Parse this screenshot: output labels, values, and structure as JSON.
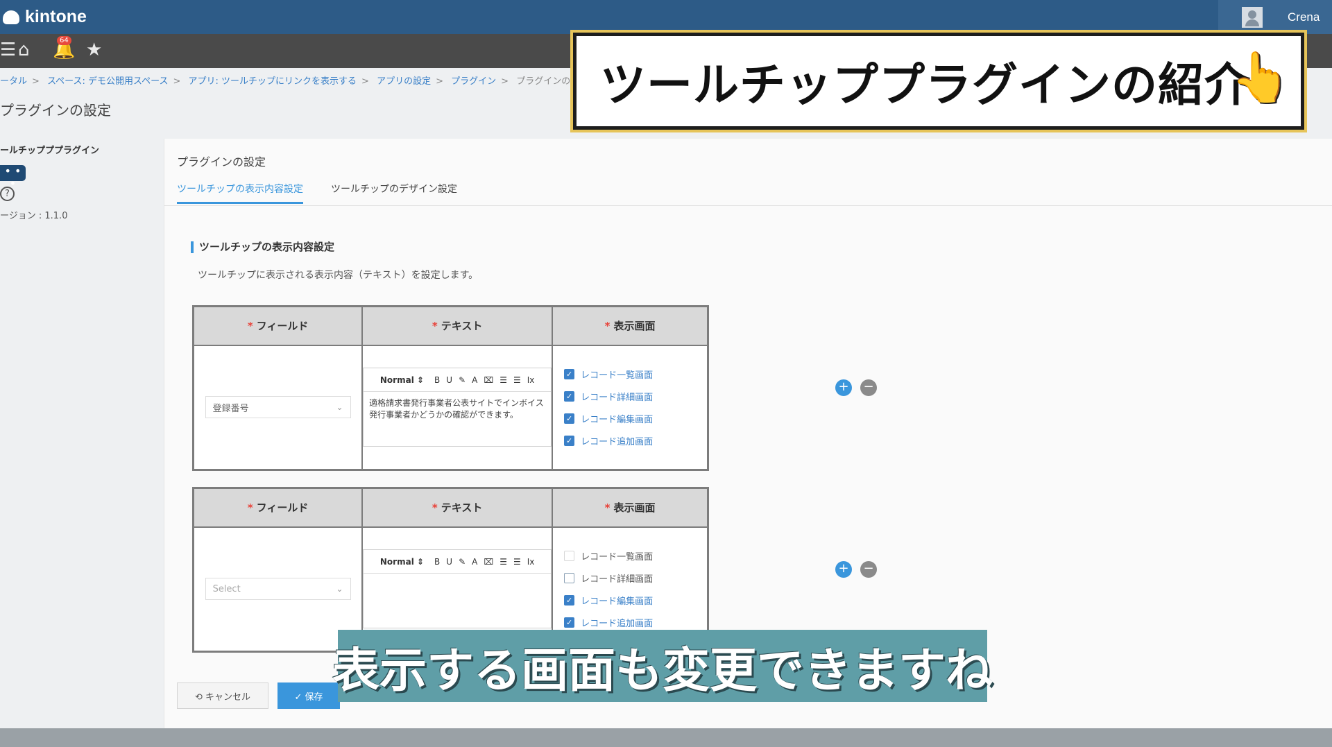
{
  "app": {
    "logo": "kintone",
    "user": "Crena",
    "notification_count": "64"
  },
  "nav": {
    "menu_icon": "☰",
    "home_icon": "⌂",
    "bell_icon": "🔔",
    "star_icon": "★"
  },
  "breadcrumb": [
    "ータル",
    "スペース: デモ公開用スペース",
    "アプリ: ツールチップにリンクを表示する",
    "アプリの設定",
    "プラグイン",
    "プラグインの設定"
  ],
  "breadcrumb_sep": ">",
  "page_title": "プラグインの設定",
  "plugin": {
    "name": "ールチップププラグイン",
    "more": "• • •",
    "help": "?",
    "version": "ージョン : 1.1.0"
  },
  "content": {
    "title": "プラグインの設定",
    "tabs": [
      {
        "label": "ツールチップの表示内容設定",
        "active": true
      },
      {
        "label": "ツールチップのデザイン設定",
        "active": false
      }
    ],
    "section_title": "ツールチップの表示内容設定",
    "section_desc": "ツールチップに表示される表示内容（テキスト）を設定します。"
  },
  "table_headers": {
    "required_mark": "*",
    "field": "フィールド",
    "text": "テキスト",
    "screens": "表示画面"
  },
  "editor_toolbar": {
    "format": "Normal ⇕",
    "items": [
      "B",
      "U",
      "✎",
      "A",
      "⌧",
      "☰",
      "☰",
      "Ix"
    ]
  },
  "rows": [
    {
      "field_value": "登録番号",
      "text_value": "適格請求書発行事業者公表サイトでインボイス発行事業者かどうかの確認ができます。",
      "screens": [
        {
          "label": "レコード一覧画面",
          "checked": true
        },
        {
          "label": "レコード詳細画面",
          "checked": true
        },
        {
          "label": "レコード編集画面",
          "checked": true
        },
        {
          "label": "レコード追加画面",
          "checked": true
        }
      ]
    },
    {
      "field_value": "Select",
      "text_value": "",
      "screens": [
        {
          "label": "レコード一覧画面",
          "checked": false
        },
        {
          "label": "レコード詳細画面",
          "checked": false
        },
        {
          "label": "レコード編集画面",
          "checked": true
        },
        {
          "label": "レコード追加画面",
          "checked": true
        }
      ]
    }
  ],
  "buttons": {
    "add": "+",
    "remove": "−",
    "cancel": "⟲ キャンセル",
    "save": "✓ 保存"
  },
  "overlay": {
    "banner": "ツールチッププラグインの紹介",
    "pointer_icon": "👆",
    "subtitle": "表示する画面も変更できますね"
  },
  "colors": {
    "topbar": "#2d5b87",
    "navbar": "#4a4a4a",
    "accent": "#3a96dc",
    "required": "#e8433a",
    "subtitle_bg": "#5f9ea7"
  }
}
